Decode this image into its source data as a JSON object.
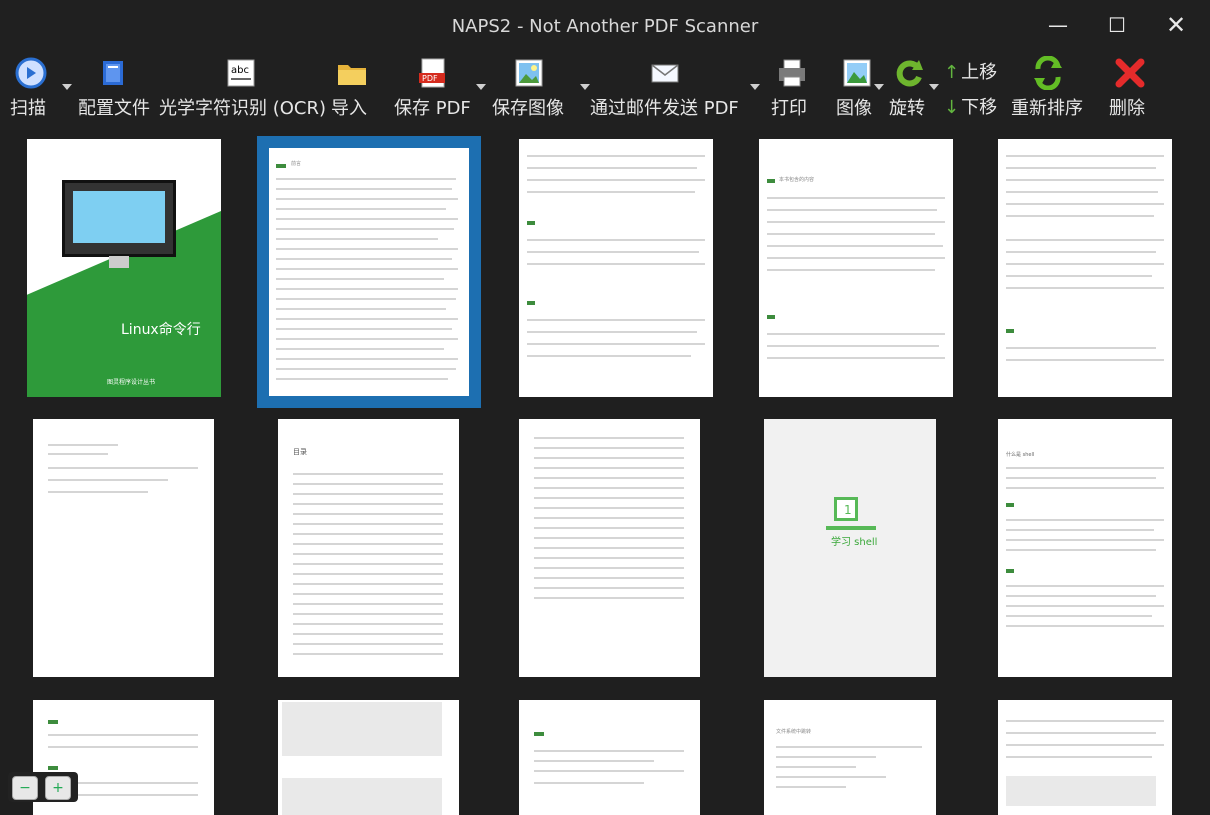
{
  "window": {
    "title": "NAPS2 - Not Another PDF Scanner",
    "controls": [
      "minimize",
      "maximize",
      "close"
    ]
  },
  "toolbar": {
    "scan": "扫描",
    "profiles": "配置文件",
    "ocr": "光学字符识别 (OCR)",
    "import": "导入",
    "save_pdf": "保存 PDF",
    "save_image": "保存图像",
    "email_pdf": "通过邮件发送 PDF",
    "print": "打印",
    "image": "图像",
    "rotate": "旋转",
    "move_up": "上移",
    "move_down": "下移",
    "reorder": "重新排序",
    "delete": "删除"
  },
  "thumbnails": [
    {
      "title": "Linux命令行",
      "publisher": "图灵程序设计丛书"
    },
    {
      "title": "前言",
      "selected": true
    },
    {
      "title": "",
      "selected": false
    },
    {
      "title": "本书包含的内容"
    },
    {
      "title": ""
    },
    {
      "title": ""
    },
    {
      "title": "目录"
    },
    {
      "title": ""
    },
    {
      "title": "学习 shell"
    },
    {
      "title": "什么是 shell"
    },
    {
      "title": ""
    },
    {
      "title": ""
    },
    {
      "title": ""
    },
    {
      "title": "文件系统中跳转"
    },
    {
      "title": ""
    }
  ],
  "zoom": {
    "out": "−",
    "in": "+"
  },
  "colors": {
    "accent": "#1d6fb1",
    "green": "#5bbf42",
    "background": "#1f1f1f"
  }
}
